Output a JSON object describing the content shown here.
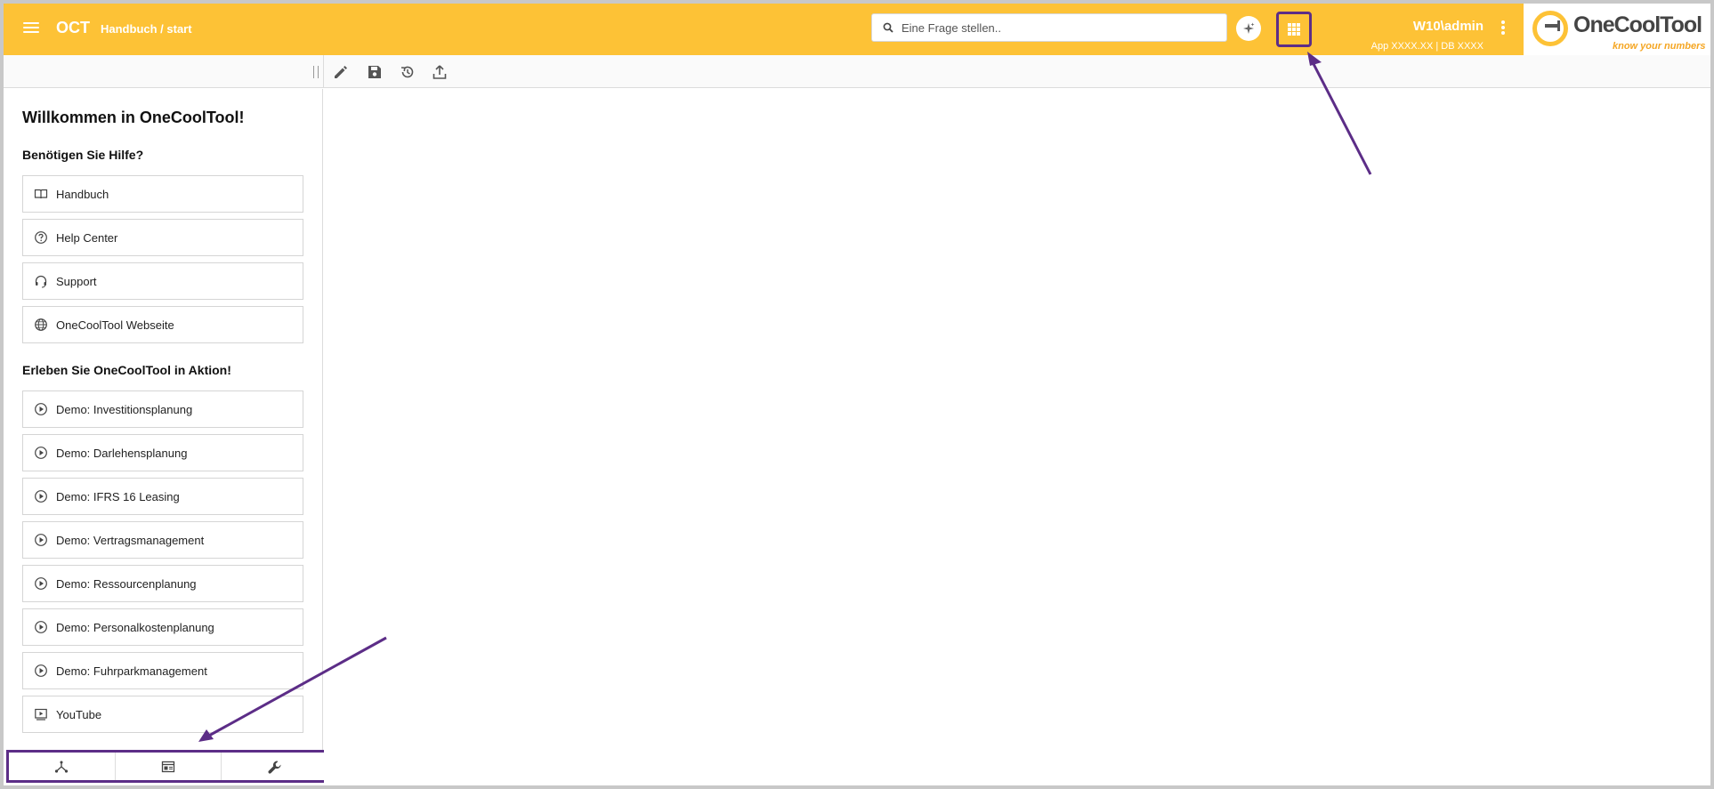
{
  "header": {
    "app_code": "OCT",
    "breadcrumb": "Handbuch / start",
    "search_placeholder": "Eine Frage stellen..",
    "user": "W10\\admin",
    "app_info": "App XXXX.XX | DB XXXX",
    "logo_text": "OneCoolTool",
    "logo_tagline": "know your numbers"
  },
  "sidebar": {
    "welcome": "Willkommen in OneCoolTool!",
    "help_title": "Benötigen Sie Hilfe?",
    "help_items": [
      {
        "label": "Handbuch",
        "icon": "book-icon"
      },
      {
        "label": "Help Center",
        "icon": "help-circle-icon"
      },
      {
        "label": "Support",
        "icon": "headset-icon"
      },
      {
        "label": "OneCoolTool Webseite",
        "icon": "globe-icon"
      }
    ],
    "demo_title": "Erleben Sie OneCoolTool in Aktion!",
    "demo_items": [
      {
        "label": "Demo: Investitionsplanung",
        "icon": "play-circle-icon"
      },
      {
        "label": "Demo: Darlehensplanung",
        "icon": "play-circle-icon"
      },
      {
        "label": "Demo: IFRS 16 Leasing",
        "icon": "play-circle-icon"
      },
      {
        "label": "Demo: Vertragsmanagement",
        "icon": "play-circle-icon"
      },
      {
        "label": "Demo: Ressourcenplanung",
        "icon": "play-circle-icon"
      },
      {
        "label": "Demo: Personalkostenplanung",
        "icon": "play-circle-icon"
      },
      {
        "label": "Demo: Fuhrparkmanagement",
        "icon": "play-circle-icon"
      },
      {
        "label": "YouTube",
        "icon": "youtube-icon"
      }
    ]
  },
  "toolbar": {
    "tools": [
      "edit-icon",
      "save-icon",
      "history-icon",
      "upload-icon"
    ]
  },
  "bottom_tabs": [
    "hierarchy-icon",
    "window-icon",
    "wrench-icon"
  ],
  "colors": {
    "header": "#fdc236",
    "annotation": "#5c2d87",
    "accent": "#f5a623"
  }
}
